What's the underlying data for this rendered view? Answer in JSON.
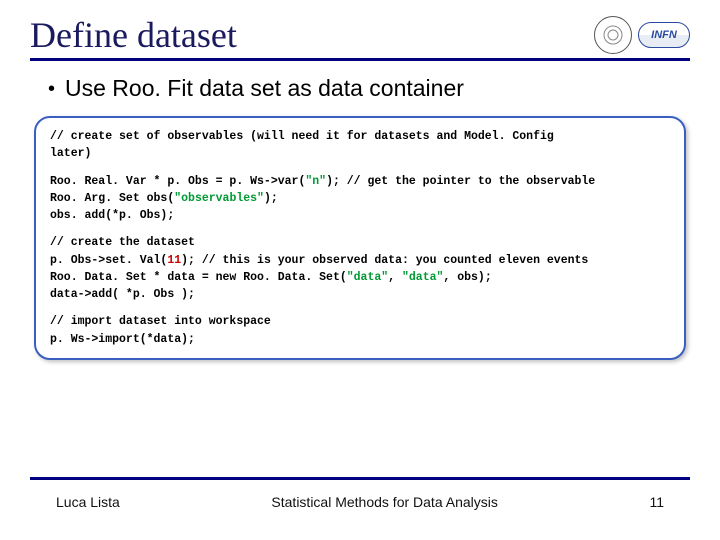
{
  "title": "Define dataset",
  "logos": {
    "infn": "INFN"
  },
  "bullet": "Use Roo. Fit data set as data container",
  "code": {
    "c1a": "// create set of observables (will need it for datasets and Model. Config",
    "c1b": "later)",
    "l1a": "Roo. Real. Var * p. Obs = p. Ws->var(",
    "s1": "\"n\"",
    "l1b": "); // get the pointer to the observable",
    "l2a": "Roo. Arg. Set obs(",
    "s2": "\"observables\"",
    "l2b": ");",
    "l3": "obs. add(*p. Obs);",
    "c2": "// create the dataset",
    "l4a": "p. Obs->set. Val(",
    "n1": "11",
    "l4b": "); // this is your observed data: you counted eleven events",
    "l5a": "Roo. Data. Set * data = new Roo. Data. Set(",
    "s3": "\"data\"",
    "l5b": ", ",
    "s4": "\"data\"",
    "l5c": ", obs);",
    "l6": "data->add( *p. Obs );",
    "c3": "// import dataset into workspace",
    "l7": "p. Ws->import(*data);"
  },
  "footer": {
    "author": "Luca Lista",
    "center": "Statistical Methods for Data Analysis",
    "page": "11"
  }
}
